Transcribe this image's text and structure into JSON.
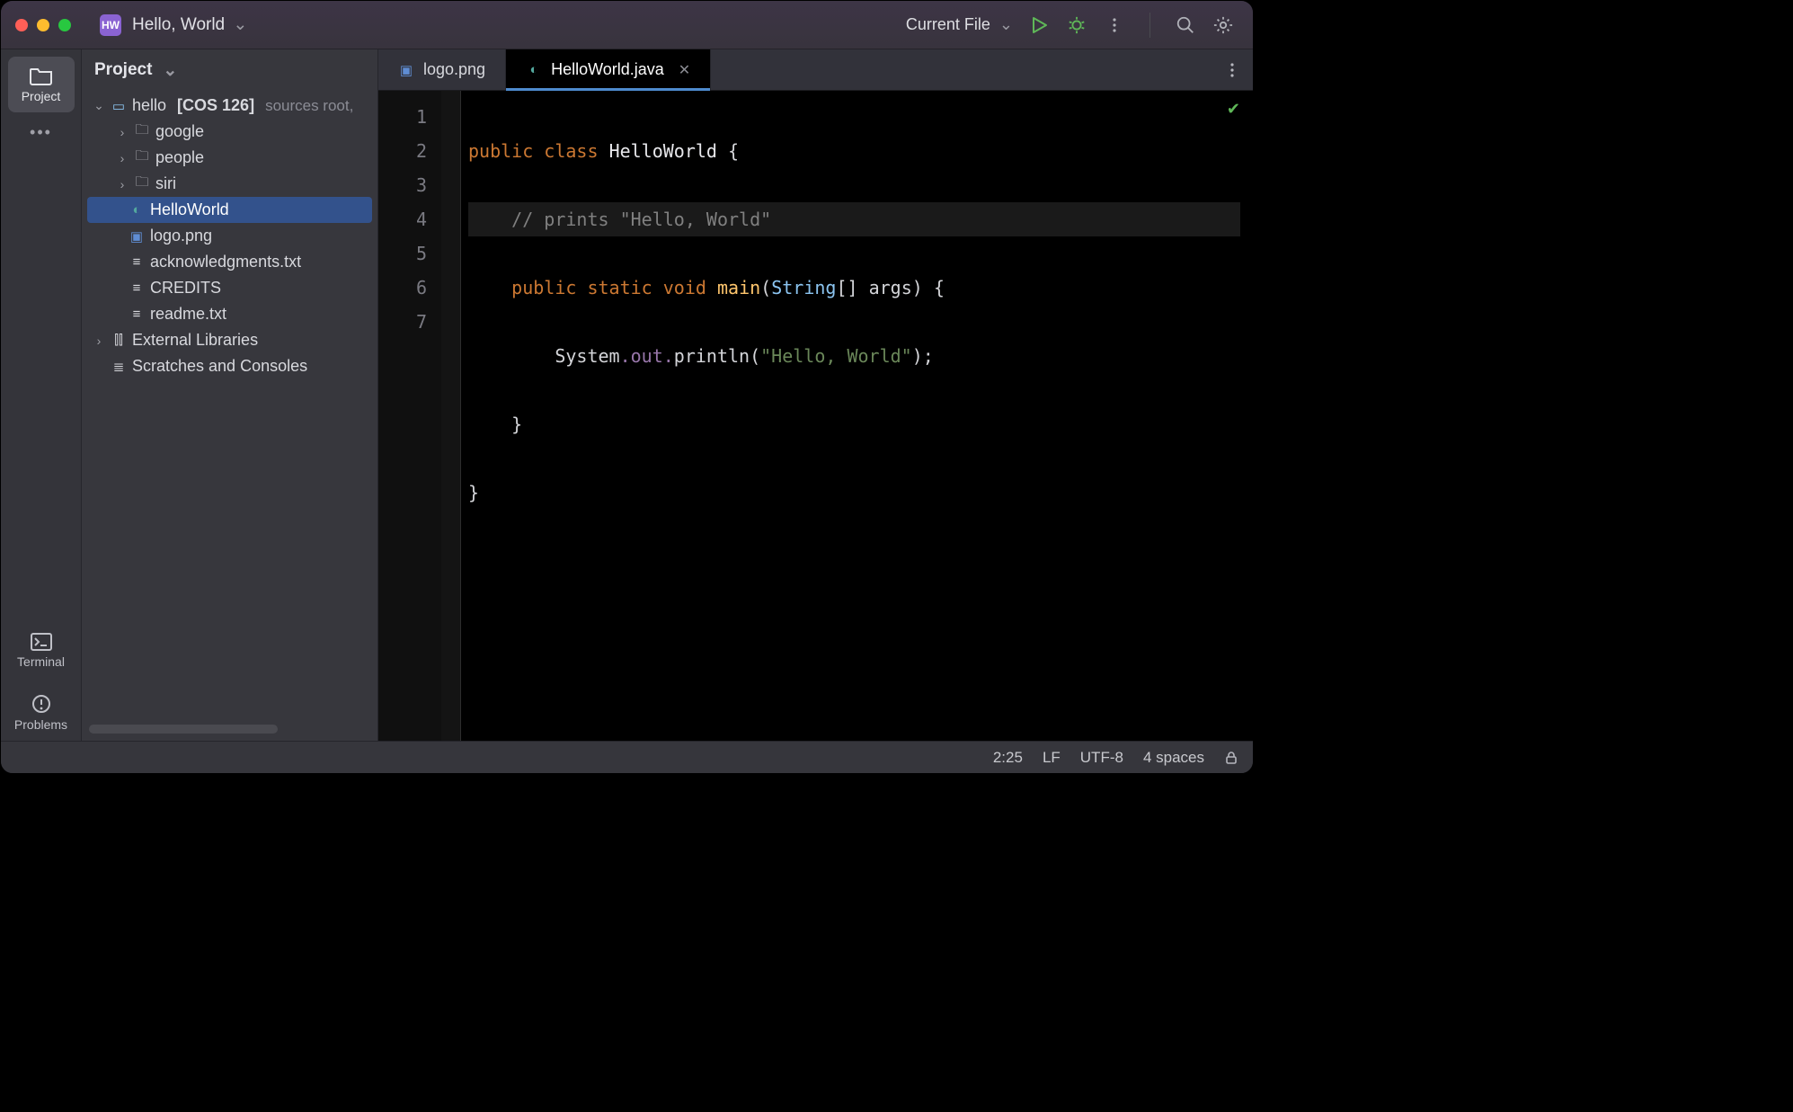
{
  "titlebar": {
    "app_badge": "HW",
    "project_name": "Hello, World",
    "run_config": "Current File"
  },
  "toolstrip": {
    "project": "Project",
    "terminal": "Terminal",
    "problems": "Problems"
  },
  "project_panel": {
    "title": "Project",
    "root": {
      "name": "hello",
      "bracket": "[COS 126]",
      "meta": "sources root,"
    },
    "folders": [
      "google",
      "people",
      "siri"
    ],
    "files": {
      "helloworld": "HelloWorld",
      "logo": "logo.png",
      "ack": "acknowledgments.txt",
      "credits": "CREDITS",
      "readme": "readme.txt"
    },
    "ext_lib": "External Libraries",
    "scratches": "Scratches and Consoles"
  },
  "tabs": {
    "t0": "logo.png",
    "t1": "HelloWorld.java"
  },
  "editor": {
    "lines": [
      "1",
      "2",
      "3",
      "4",
      "5",
      "6",
      "7"
    ],
    "code": {
      "l1_kw1": "public",
      "l1_kw2": "class",
      "l1_cls": "HelloWorld",
      "l1_brace": " {",
      "l2": "    // prints \"Hello, World\"",
      "l3_kw1": "public",
      "l3_kw2": "static",
      "l3_kw3": "void",
      "l3_mth": "main",
      "l3_p1": "(",
      "l3_type": "String",
      "l3_arr": "[] ",
      "l3_args": "args",
      "l3_p2": ") {",
      "l4_pre": "System",
      "l4_out": ".out.",
      "l4_pl": "println",
      "l4_p1": "(",
      "l4_str": "\"Hello, World\"",
      "l4_p2": ");",
      "l5": "    }",
      "l6": "}"
    }
  },
  "status": {
    "pos": "2:25",
    "le": "LF",
    "enc": "UTF-8",
    "indent": "4 spaces"
  }
}
